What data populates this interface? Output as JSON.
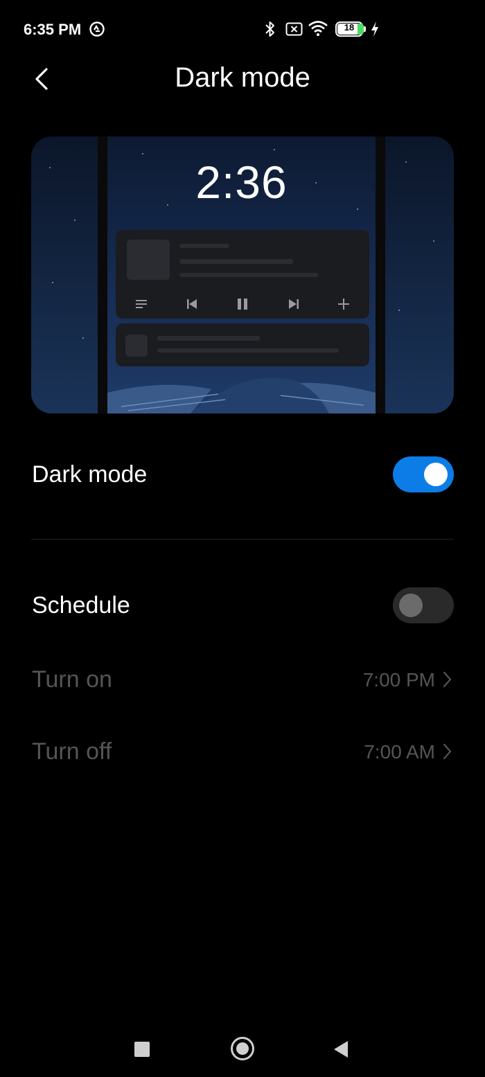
{
  "status_bar": {
    "time": "6:35 PM",
    "battery": "18",
    "icons": [
      "sync-icon",
      "bluetooth-icon",
      "no-sim-icon",
      "wifi-icon",
      "battery-icon",
      "charging-icon"
    ]
  },
  "header": {
    "title": "Dark mode",
    "back_icon": "chevron-left-icon"
  },
  "preview": {
    "clock": "2:36",
    "media_icons": [
      "playlist-icon",
      "previous-icon",
      "pause-icon",
      "next-icon",
      "add-icon"
    ]
  },
  "settings": {
    "dark_mode": {
      "label": "Dark mode",
      "enabled": true
    },
    "schedule": {
      "label": "Schedule",
      "enabled": false
    },
    "turn_on": {
      "label": "Turn on",
      "value": "7:00 PM"
    },
    "turn_off": {
      "label": "Turn off",
      "value": "7:00 AM"
    }
  },
  "colors": {
    "background": "#000000",
    "accent": "#0c7de6",
    "dim_text": "#555555"
  },
  "nav_bar": {
    "buttons": [
      "recents-button",
      "home-button",
      "back-button"
    ]
  }
}
